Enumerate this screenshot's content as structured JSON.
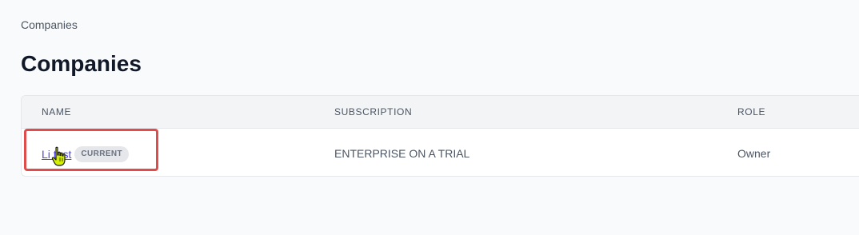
{
  "breadcrumb": {
    "label": "Companies"
  },
  "page": {
    "title": "Companies"
  },
  "table": {
    "columns": [
      "NAME",
      "SUBSCRIPTION",
      "ROLE"
    ],
    "rows": [
      {
        "name": "Li test",
        "badge": "CURRENT",
        "subscription": "ENTERPRISE ON A TRIAL",
        "role": "Owner"
      }
    ]
  },
  "colors": {
    "link": "#4f46e5",
    "highlight": "#e04b4b",
    "cursor": "#d4f000"
  },
  "icons": {
    "cursor": "hand-pointer-icon"
  }
}
